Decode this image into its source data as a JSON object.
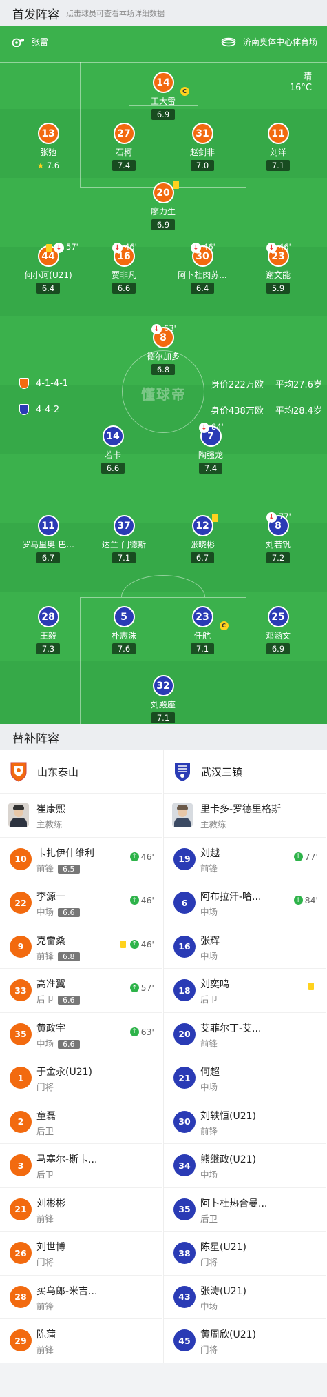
{
  "header": {
    "title": "首发阵容",
    "subtitle": "点击球员可查看本场详细数据"
  },
  "match": {
    "referee": "张雷",
    "venue": "济南奥体中心体育场",
    "weather": "晴",
    "temperature": "16°C",
    "watermark": "懂球帝"
  },
  "home_team": {
    "name": "山东泰山",
    "formation": "4-1-4-1",
    "value": "身价222万欧",
    "avg_age": "平均27.6岁",
    "color": "#f26a0f"
  },
  "away_team": {
    "name": "武汉三镇",
    "formation": "4-4-2",
    "value": "身价438万欧",
    "avg_age": "平均28.4岁",
    "color": "#2a3bb5"
  },
  "home_lineup": [
    {
      "number": "14",
      "name": "王大雷",
      "rating": "6.9",
      "captain": true
    },
    {
      "number": "13",
      "name": "张弛",
      "rating": "7.6",
      "star": true
    },
    {
      "number": "27",
      "name": "石柯",
      "rating": "7.4"
    },
    {
      "number": "31",
      "name": "赵剑非",
      "rating": "7.0"
    },
    {
      "number": "11",
      "name": "刘洋",
      "rating": "7.1"
    },
    {
      "number": "20",
      "name": "廖力生",
      "rating": "6.9",
      "yellow": true
    },
    {
      "number": "44",
      "name": "何小珂(U21)",
      "rating": "6.4",
      "yellow": true,
      "sub_off": "57'"
    },
    {
      "number": "16",
      "name": "贾非凡",
      "rating": "6.6",
      "sub_off": "46'"
    },
    {
      "number": "30",
      "name": "阿卜杜肉苏...",
      "rating": "6.4",
      "sub_off": "46'"
    },
    {
      "number": "23",
      "name": "谢文能",
      "rating": "5.9",
      "sub_off": "46'"
    },
    {
      "number": "8",
      "name": "德尔加多",
      "rating": "6.8",
      "sub_off": "63'"
    }
  ],
  "away_lineup": [
    {
      "number": "14",
      "name": "若卡",
      "rating": "6.6"
    },
    {
      "number": "7",
      "name": "陶强龙",
      "rating": "7.4",
      "sub_off": "84'"
    },
    {
      "number": "11",
      "name": "罗马里奥-巴...",
      "rating": "6.7"
    },
    {
      "number": "37",
      "name": "达兰-门德斯",
      "rating": "7.1"
    },
    {
      "number": "12",
      "name": "张晓彬",
      "rating": "6.7",
      "yellow": true
    },
    {
      "number": "8",
      "name": "刘若钒",
      "rating": "7.2",
      "sub_off": "77'"
    },
    {
      "number": "28",
      "name": "王毅",
      "rating": "7.3"
    },
    {
      "number": "5",
      "name": "朴志洙",
      "rating": "7.6"
    },
    {
      "number": "23",
      "name": "任航",
      "rating": "7.1",
      "captain": true
    },
    {
      "number": "25",
      "name": "邓涵文",
      "rating": "6.9"
    },
    {
      "number": "32",
      "name": "刘殿座",
      "rating": "7.1"
    }
  ],
  "bench": {
    "title": "替补阵容",
    "home_coach": {
      "name": "崔康熙",
      "role": "主教练"
    },
    "away_coach": {
      "name": "里卡多-罗德里格斯",
      "role": "主教练"
    },
    "home": [
      {
        "number": "10",
        "name": "卡扎伊什维利",
        "pos": "前锋",
        "rating": "6.5",
        "sub_on": "46'"
      },
      {
        "number": "22",
        "name": "李源一",
        "pos": "中场",
        "rating": "6.6",
        "sub_on": "46'"
      },
      {
        "number": "9",
        "name": "克雷桑",
        "pos": "前锋",
        "rating": "6.8",
        "sub_on": "46'",
        "yellow": true
      },
      {
        "number": "33",
        "name": "高准翼",
        "pos": "后卫",
        "rating": "6.6",
        "sub_on": "57'"
      },
      {
        "number": "35",
        "name": "黄政宇",
        "pos": "中场",
        "rating": "6.6",
        "sub_on": "63'"
      },
      {
        "number": "1",
        "name": "于金永(U21)",
        "pos": "门将"
      },
      {
        "number": "2",
        "name": "童磊",
        "pos": "后卫"
      },
      {
        "number": "3",
        "name": "马塞尔-斯卡...",
        "pos": "后卫"
      },
      {
        "number": "21",
        "name": "刘彬彬",
        "pos": "前锋"
      },
      {
        "number": "26",
        "name": "刘世博",
        "pos": "门将"
      },
      {
        "number": "28",
        "name": "买乌郎-米吉...",
        "pos": "前锋"
      },
      {
        "number": "29",
        "name": "陈蒲",
        "pos": "前锋"
      }
    ],
    "away": [
      {
        "number": "19",
        "name": "刘越",
        "pos": "前锋",
        "sub_on": "77'"
      },
      {
        "number": "6",
        "name": "阿布拉汗-哈...",
        "pos": "中场",
        "sub_on": "84'"
      },
      {
        "number": "16",
        "name": "张辉",
        "pos": "中场"
      },
      {
        "number": "18",
        "name": "刘奕鸣",
        "pos": "后卫",
        "yellow": true
      },
      {
        "number": "20",
        "name": "艾菲尔丁-艾...",
        "pos": "前锋"
      },
      {
        "number": "21",
        "name": "何超",
        "pos": "中场"
      },
      {
        "number": "30",
        "name": "刘轶恒(U21)",
        "pos": "前锋"
      },
      {
        "number": "34",
        "name": "熊继政(U21)",
        "pos": "中场"
      },
      {
        "number": "35",
        "name": "阿卜杜热合曼...",
        "pos": "后卫"
      },
      {
        "number": "38",
        "name": "陈星(U21)",
        "pos": "门将"
      },
      {
        "number": "43",
        "name": "张涛(U21)",
        "pos": "中场"
      },
      {
        "number": "45",
        "name": "黄周欣(U21)",
        "pos": "门将"
      }
    ]
  }
}
